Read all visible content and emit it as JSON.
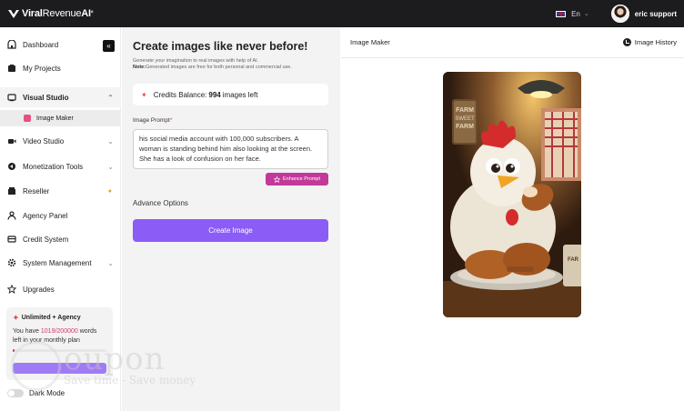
{
  "app": {
    "logo_main": "Viral",
    "logo_light": "Revenue",
    "logo_ai": "AI",
    "logo_ai_mark": "°",
    "language": "En",
    "username": "eric support"
  },
  "sidebar": {
    "items": [
      {
        "label": "Dashboard",
        "icon": "dashboard-icon"
      },
      {
        "label": "My Projects",
        "icon": "projects-icon"
      },
      {
        "label": "Visual Studio",
        "icon": "visual-studio-icon"
      },
      {
        "label": "Image Maker",
        "icon": "image-icon"
      },
      {
        "label": "Video Studio",
        "icon": "video-icon"
      },
      {
        "label": "Monetization Tools",
        "icon": "monetization-icon"
      },
      {
        "label": "Reseller",
        "icon": "reseller-icon"
      },
      {
        "label": "Agency Panel",
        "icon": "agency-icon"
      },
      {
        "label": "Credit System",
        "icon": "credit-icon"
      },
      {
        "label": "System Management",
        "icon": "gear-icon"
      },
      {
        "label": "Upgrades",
        "icon": "star-icon"
      }
    ],
    "plan": {
      "title": "Unlimited + Agency",
      "text_before": "You have",
      "count": "1019/200000",
      "text_after": "words left in your monthly plan",
      "usage_fraction": 0.0051
    },
    "dark_mode_label": "Dark Mode"
  },
  "editor": {
    "title": "Create images like never before!",
    "subtitle": "Generate your imagination to real images with help of AI.",
    "note_label": "Note:",
    "note_text": "Generated images are free for both personal and commercial use.",
    "credits_label": "Credits Balance:",
    "credits_value": "994",
    "credits_suffix": "images left",
    "prompt_label": "Image Prompt",
    "prompt_required": "*",
    "prompt_value": "his social media account with 100,000 subscribers. A woman is standing behind him also looking at the screen. She has a look of confusion on her face.",
    "enhance_label": "Enhance Prompt",
    "advance_label": "Advance Options",
    "create_label": "Create Image"
  },
  "preview": {
    "title": "Image Maker",
    "history_label": "Image History",
    "sign_text_1": "FARM",
    "sign_text_2": "SWEET",
    "sign_text_3": "FARM",
    "mug_text": "FAR"
  },
  "watermark": {
    "main": "oupon",
    "tagline": "Save time - Save money"
  },
  "colors": {
    "accent": "#8b5cf6",
    "enhance": "#c2399a",
    "topbar": "#1c1c1f",
    "danger": "#e24848"
  }
}
